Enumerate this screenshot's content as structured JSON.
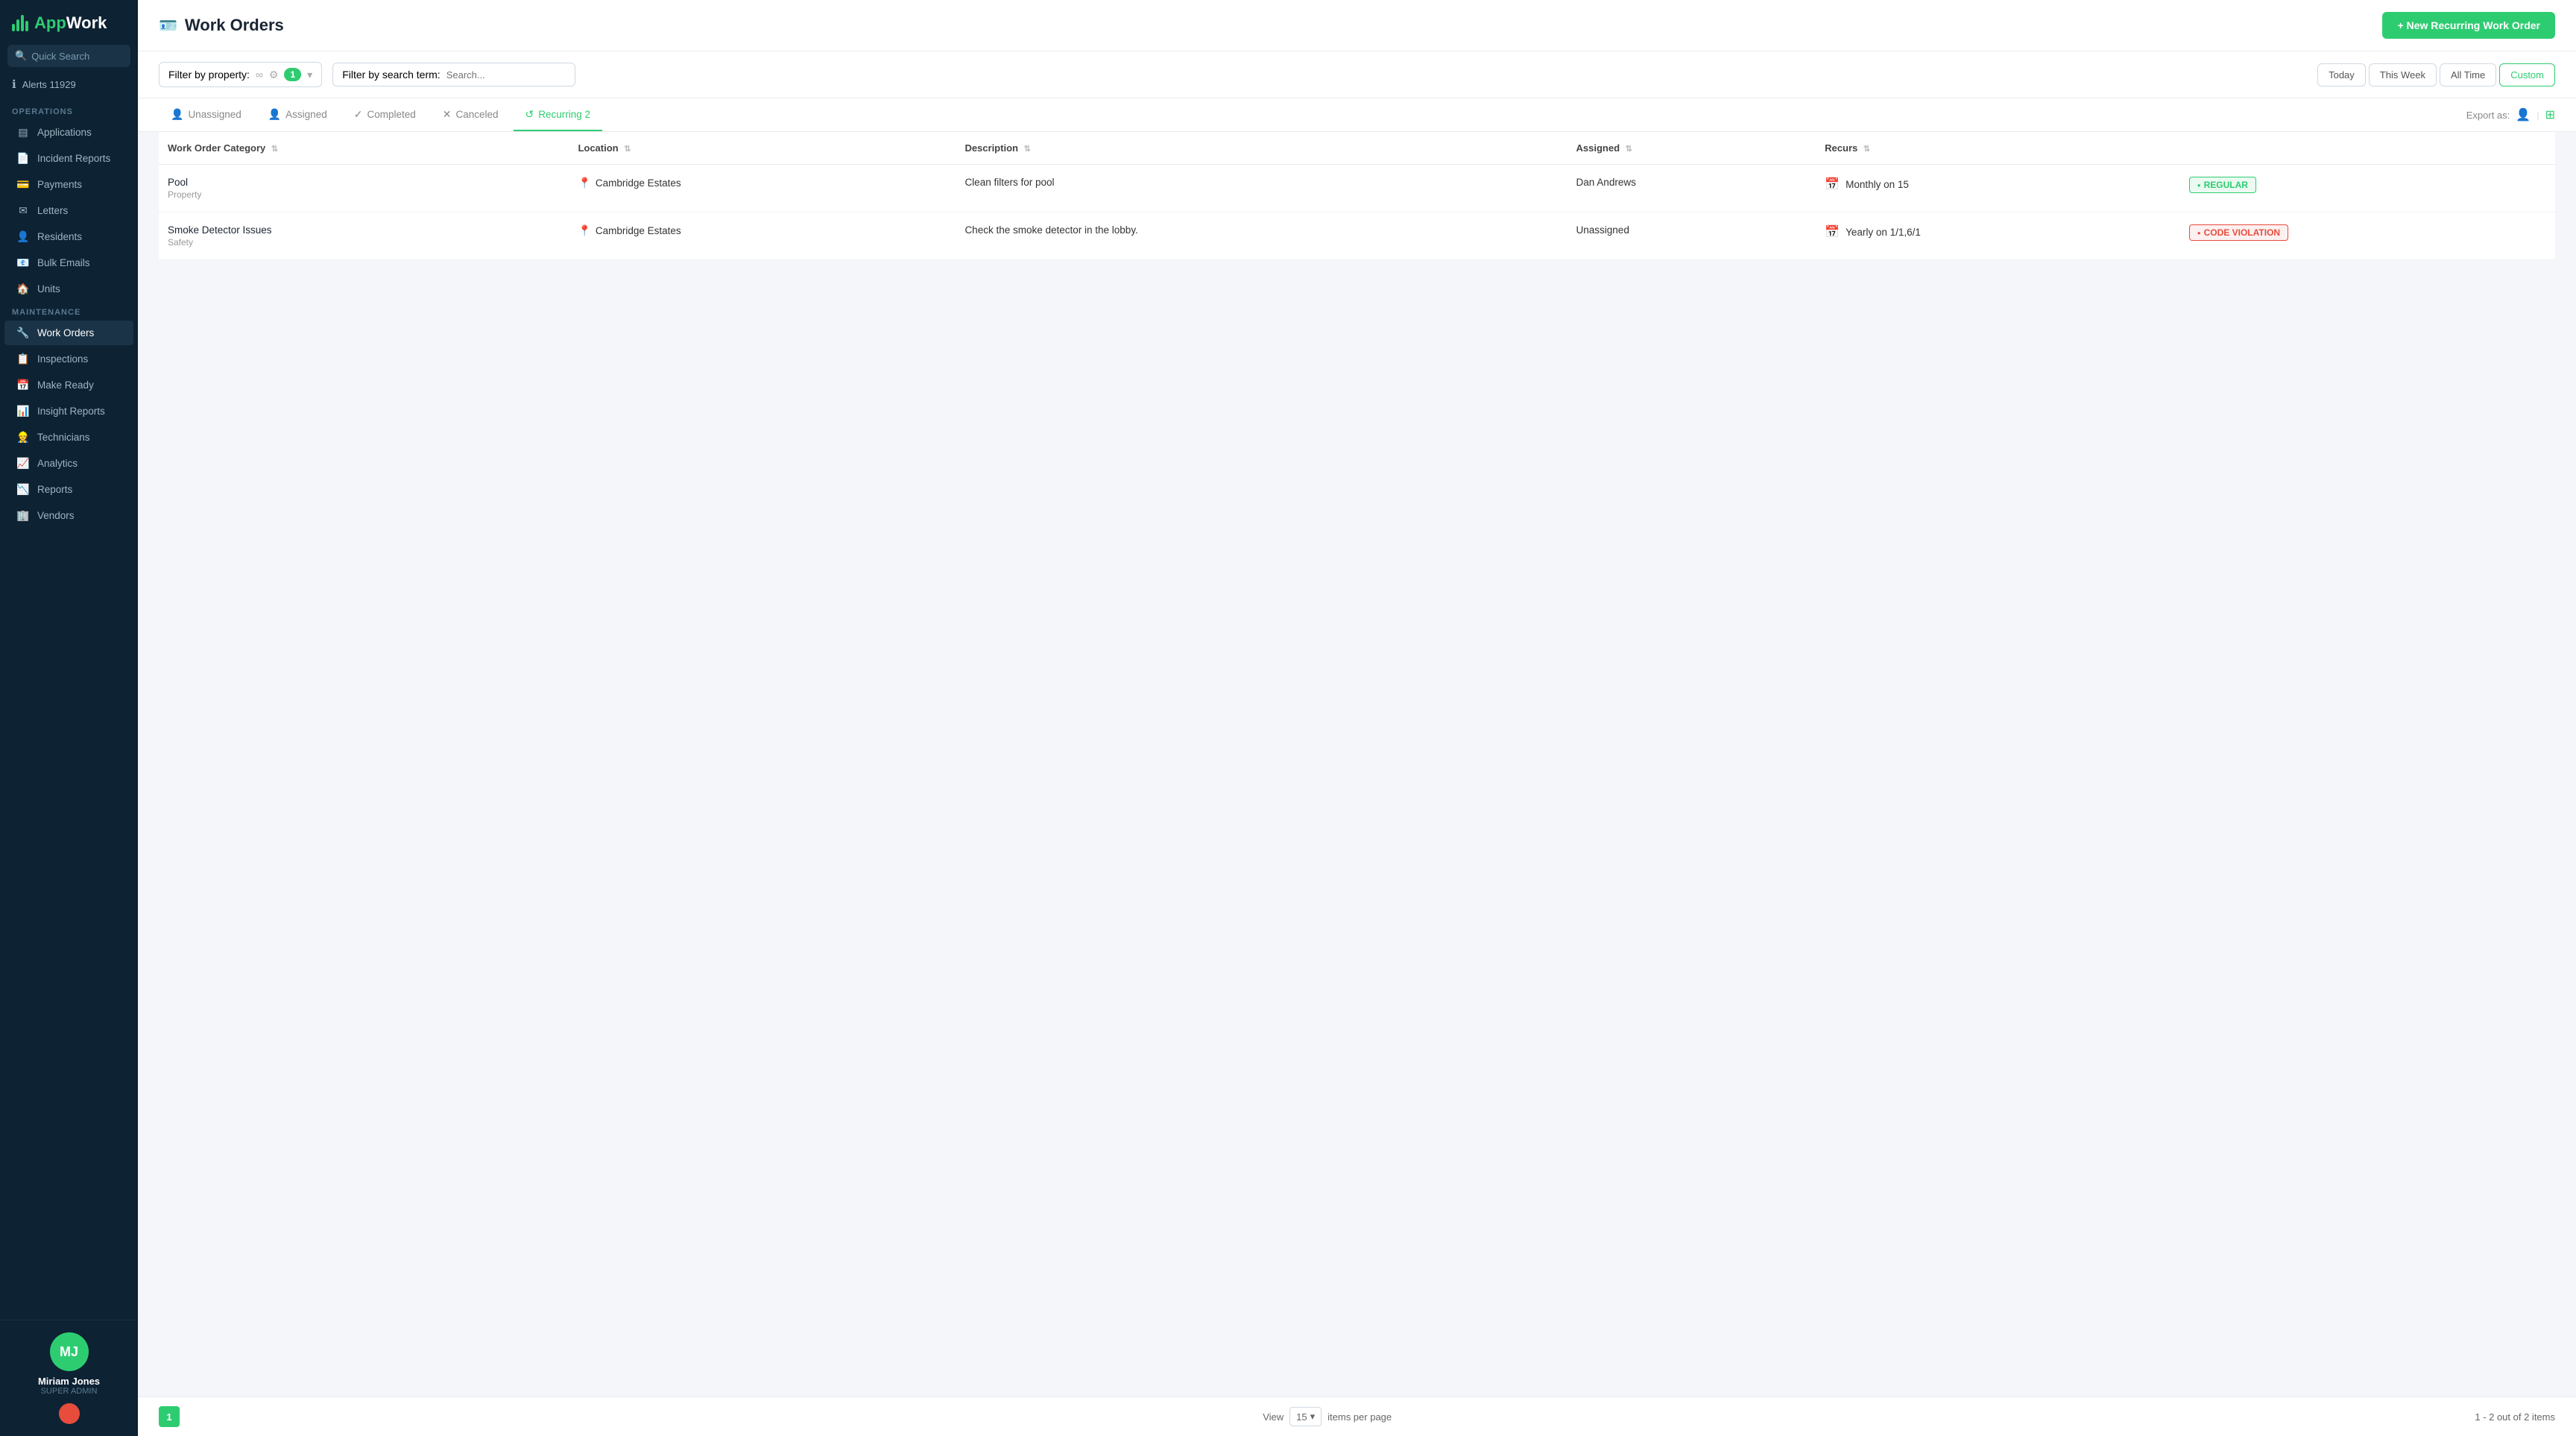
{
  "app": {
    "name": "AppWork",
    "logo_initials": "App",
    "logo_accent": "Work"
  },
  "sidebar": {
    "search_placeholder": "Quick Search",
    "alert_label": "Alerts 11929",
    "sections": [
      {
        "label": "OPERATIONS",
        "items": [
          {
            "id": "applications",
            "label": "Applications",
            "icon": "▤"
          },
          {
            "id": "incident-reports",
            "label": "Incident Reports",
            "icon": "📄"
          },
          {
            "id": "payments",
            "label": "Payments",
            "icon": "💳"
          },
          {
            "id": "letters",
            "label": "Letters",
            "icon": "✉"
          },
          {
            "id": "residents",
            "label": "Residents",
            "icon": "👤"
          },
          {
            "id": "bulk-emails",
            "label": "Bulk Emails",
            "icon": "📧"
          },
          {
            "id": "units",
            "label": "Units",
            "icon": "🏠"
          }
        ]
      },
      {
        "label": "MAINTENANCE",
        "items": [
          {
            "id": "work-orders",
            "label": "Work Orders",
            "icon": "🔧",
            "active": true
          },
          {
            "id": "inspections",
            "label": "Inspections",
            "icon": "📋"
          },
          {
            "id": "make-ready",
            "label": "Make Ready",
            "icon": "📅"
          },
          {
            "id": "insight-reports",
            "label": "Insight Reports",
            "icon": "📊"
          },
          {
            "id": "technicians",
            "label": "Technicians",
            "icon": "👷"
          },
          {
            "id": "analytics",
            "label": "Analytics",
            "icon": "📈"
          },
          {
            "id": "reports",
            "label": "Reports",
            "icon": "📉"
          },
          {
            "id": "vendors",
            "label": "Vendors",
            "icon": "🏢"
          }
        ]
      }
    ],
    "user": {
      "initials": "MJ",
      "name": "Miriam Jones",
      "role": "SUPER ADMIN"
    }
  },
  "header": {
    "page_icon": "🪪",
    "page_title": "Work Orders",
    "new_button_label": "+ New Recurring Work Order"
  },
  "filters": {
    "property_label": "Filter by property:",
    "property_badge": "1",
    "search_label": "Filter by search term:",
    "search_placeholder": "Search...",
    "time_buttons": [
      {
        "label": "Today",
        "active": false
      },
      {
        "label": "This Week",
        "active": false
      },
      {
        "label": "All Time",
        "active": false
      },
      {
        "label": "Custom",
        "active": true
      }
    ]
  },
  "tabs": [
    {
      "id": "unassigned",
      "label": "Unassigned",
      "icon": "👤",
      "active": false
    },
    {
      "id": "assigned",
      "label": "Assigned",
      "icon": "👤",
      "active": false
    },
    {
      "id": "completed",
      "label": "Completed",
      "icon": "✓",
      "active": false
    },
    {
      "id": "canceled",
      "label": "Canceled",
      "icon": "✕",
      "active": false
    },
    {
      "id": "recurring",
      "label": "Recurring 2",
      "icon": "↺",
      "active": true
    }
  ],
  "export": {
    "label": "Export as:"
  },
  "table": {
    "columns": [
      {
        "id": "category",
        "label": "Work Order Category"
      },
      {
        "id": "location",
        "label": "Location"
      },
      {
        "id": "description",
        "label": "Description"
      },
      {
        "id": "assigned",
        "label": "Assigned"
      },
      {
        "id": "recurs",
        "label": "Recurs"
      },
      {
        "id": "tag",
        "label": ""
      }
    ],
    "rows": [
      {
        "id": 1,
        "category": "Pool",
        "category_sub": "Property",
        "location": "Cambridge Estates",
        "description": "Clean filters for pool",
        "assigned": "Dan Andrews",
        "recurs": "Monthly on 15",
        "tag": "REGULAR",
        "tag_type": "regular"
      },
      {
        "id": 2,
        "category": "Smoke Detector Issues",
        "category_sub": "Safety",
        "location": "Cambridge Estates",
        "description": "Check the smoke detector in the lobby.",
        "assigned": "Unassigned",
        "recurs": "Yearly on 1/1,6/1",
        "tag": "CODE VIOLATION",
        "tag_type": "violation"
      }
    ]
  },
  "pagination": {
    "current_page": "1",
    "view_label": "View",
    "items_per_page": "15",
    "items_per_page_label": "items per page",
    "total_label": "1 - 2 out of 2 items"
  }
}
